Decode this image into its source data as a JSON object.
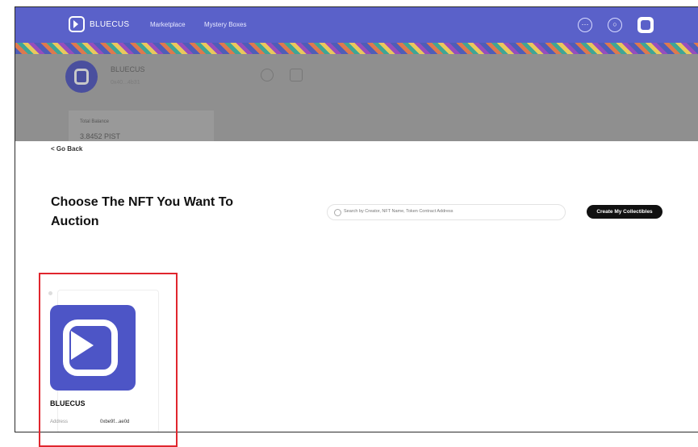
{
  "header": {
    "brand": "BLUECUS",
    "nav": [
      "Marketplace",
      "Mystery Boxes"
    ],
    "icons": [
      "more-icon",
      "search-icon",
      "profile-avatar-icon"
    ],
    "color": "#5a61c9"
  },
  "profile": {
    "name": "BLUECUS",
    "sub": "0x40...4b31",
    "balance_label": "Total Balance",
    "balance_value": "3.8452 PIST"
  },
  "page": {
    "go_back": "< Go Back",
    "title": "Choose The NFT You Want To Auction",
    "search_placeholder": "Search by Creator, NFT Name, Token Contract Address",
    "create_button": "Create My Collectibles"
  },
  "nft_card": {
    "name": "BLUECUS",
    "address_label": "Address",
    "address_value": "0xbe9f...ae0d"
  }
}
